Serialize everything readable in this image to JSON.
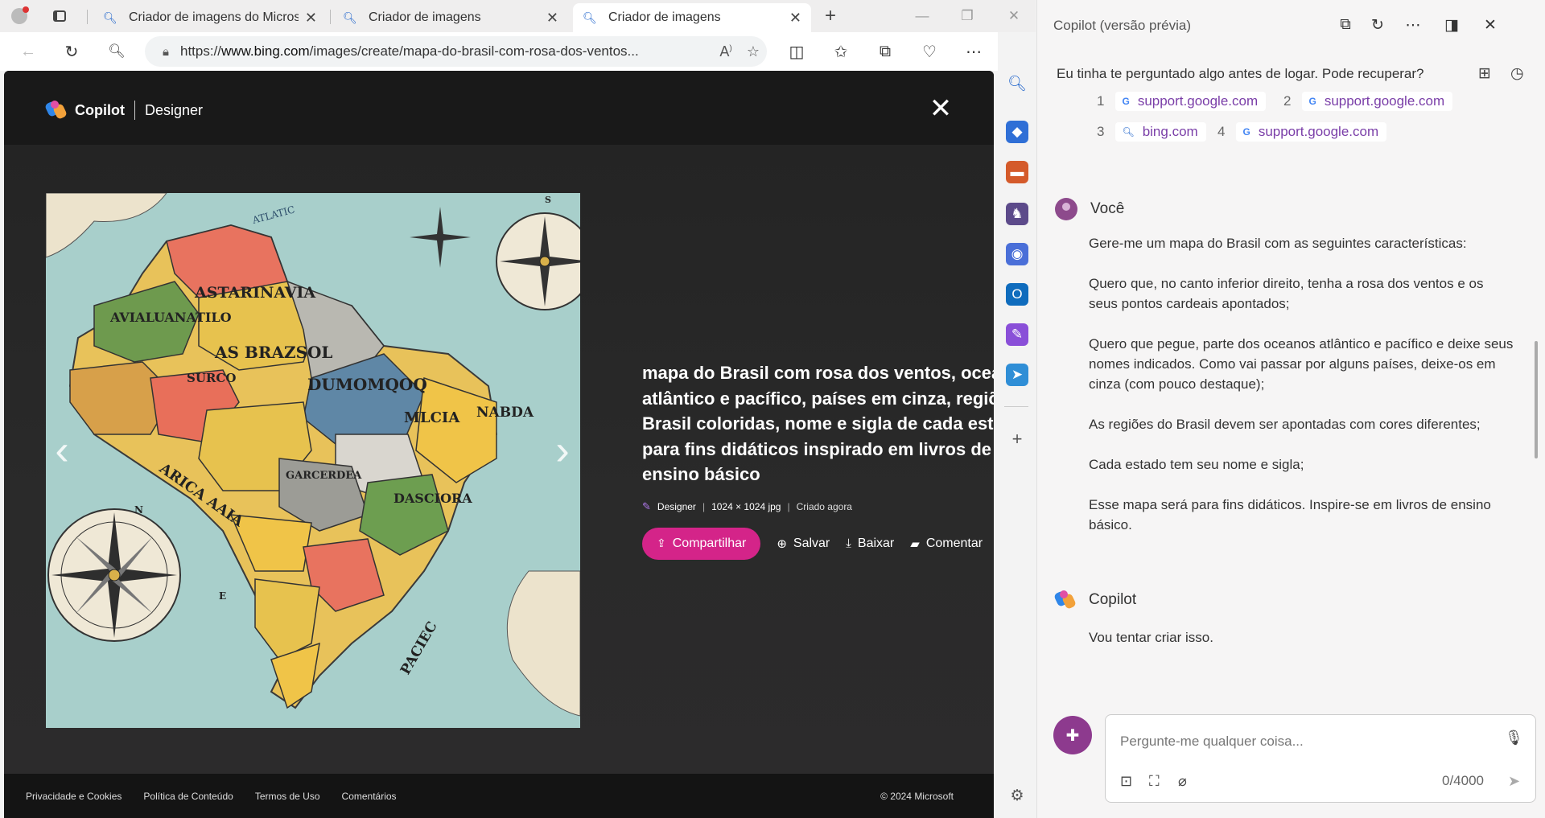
{
  "browser": {
    "tabs": [
      {
        "label": "Criador de imagens do Microsoft",
        "active": false
      },
      {
        "label": "Criador de imagens",
        "active": false
      },
      {
        "label": "Criador de imagens",
        "active": true
      }
    ],
    "url_prefix": "https://",
    "url_host": "www.bing.com",
    "url_path": "/images/create/mapa-do-brasil-com-rosa-dos-ventos...",
    "colors": {
      "accent": "#d42489",
      "copilot_avatar": "#8d3a8e"
    }
  },
  "modal": {
    "brand": "Copilot",
    "product": "Designer",
    "image_title": "mapa do Brasil com rosa dos ventos, oceano atlântico e pacífico, países em cinza, regiões do Brasil coloridas, nome e sigla de cada estado para fins didáticos inspirado em livros de ensino básico",
    "title_lines": [
      "mapa do Brasil com rosa dos ventos, oceano",
      "atlântico e pacífico, países em cinza, regiões",
      "Brasil coloridas, nome e sigla de cada estado",
      "para fins didáticos inspirado em livros de",
      "ensino básico"
    ],
    "creator": "Designer",
    "dimensions": "1024 × 1024 jpg",
    "created": "Criado agora",
    "actions": {
      "share": "Compartilhar",
      "save": "Salvar",
      "download": "Baixar",
      "comment": "Comentar"
    }
  },
  "map_labels": {
    "north": "N",
    "east": "E",
    "south": "S",
    "atlantic": "ATLATIC",
    "pacific": "PACIEC",
    "africa": "ARICA AAIA",
    "states": [
      "ASTARINAVIA",
      "AS BRAZSOL",
      "AVIALUANATILO",
      "DUMOMQOQ",
      "NABDA",
      "MLCIA",
      "SURCO",
      "DASCIORA",
      "GARCERDEA"
    ]
  },
  "footer": {
    "links": [
      "Privacidade e Cookies",
      "Política de Conteúdo",
      "Termos de Uso",
      "Comentários"
    ],
    "copyright": "© 2024 Microsoft"
  },
  "copilot": {
    "header_title": "Copilot (versão prévia)",
    "previous_message": "Eu tinha te perguntado algo antes de logar. Pode recuperar?",
    "citations": [
      {
        "num": "1",
        "source": "support.google.com"
      },
      {
        "num": "2",
        "source": "support.google.com"
      },
      {
        "num": "3",
        "source": "bing.com"
      },
      {
        "num": "4",
        "source": "support.google.com"
      }
    ],
    "user_name": "Você",
    "user_message": [
      "Gere-me um mapa do Brasil com as seguintes características:",
      "Quero que, no canto inferior direito, tenha a rosa dos ventos e os seus pontos cardeais apontados;",
      "Quero que pegue, parte dos oceanos atlântico e pacífico e deixe seus nomes indicados. Como vai passar por alguns países, deixe-os em cinza (com pouco destaque);",
      "As regiões do Brasil devem ser apontadas com cores diferentes;",
      "Cada estado tem seu nome e sigla;",
      "Esse mapa será para fins didáticos. Inspire-se em livros de ensino básico."
    ],
    "bot_name": "Copilot",
    "bot_message": "Vou tentar criar isso.",
    "input_placeholder": "Pergunte-me qualquer coisa...",
    "char_count": "0/4000"
  }
}
